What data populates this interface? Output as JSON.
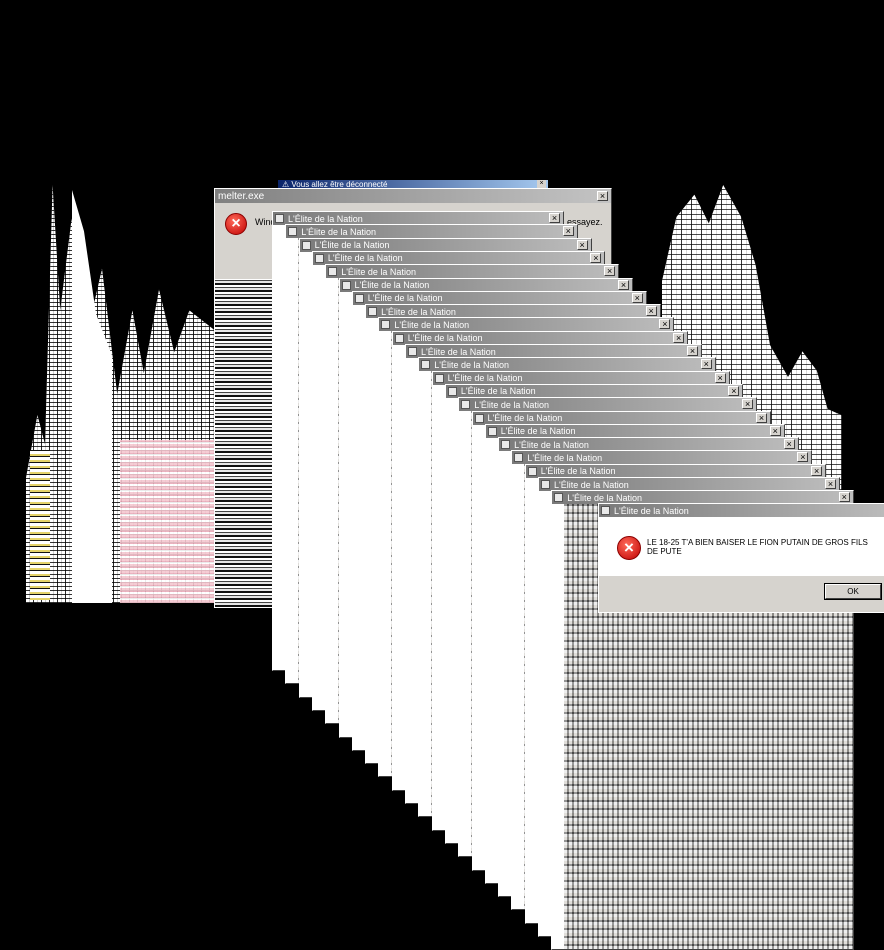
{
  "background_dialog": {
    "title": "melter.exe",
    "message_start": "Wind",
    "message_end": "essayez.",
    "close_glyph": "×",
    "icon_glyph": "×"
  },
  "top_window": {
    "title": "Vous allez être déconnecté",
    "close_glyph": "×"
  },
  "cascade_windows": {
    "title": "L'Élite de la Nation",
    "close_glyph": "×"
  },
  "front_dialog": {
    "title": "L'Élite de la Nation",
    "message": "LE 18-25 T'A BIEN BAISER LE FION PUTAIN DE GROS FILS DE PUTE",
    "ok_label": "OK",
    "close_glyph": "×",
    "icon_glyph": "×"
  },
  "colors": {
    "desktop": "#000000",
    "dialog_face": "#d6d3ce",
    "titlebar_inactive": "#808080",
    "titlebar_active": "#0a246a",
    "error_red": "#c00000"
  },
  "icons": [
    "error-icon",
    "app-icon",
    "close-icon",
    "warning-icon"
  ]
}
